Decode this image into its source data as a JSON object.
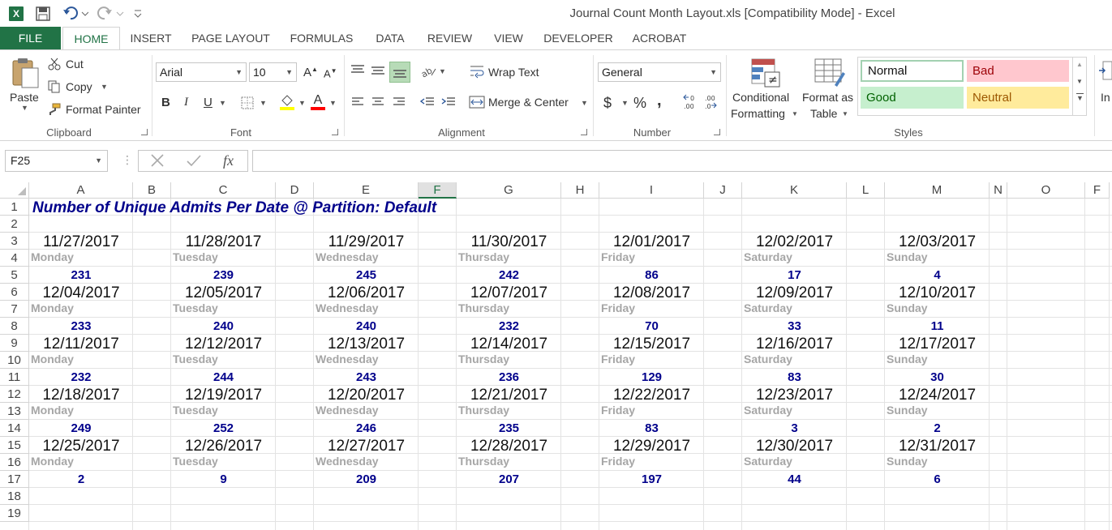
{
  "title_bar": {
    "window_title": "Journal Count Month Layout.xls  [Compatibility Mode] - Excel"
  },
  "tabs": [
    "FILE",
    "HOME",
    "INSERT",
    "PAGE LAYOUT",
    "FORMULAS",
    "DATA",
    "REVIEW",
    "VIEW",
    "DEVELOPER",
    "ACROBAT"
  ],
  "ribbon": {
    "clipboard": {
      "paste": "Paste",
      "cut": "Cut",
      "copy": "Copy",
      "format_painter": "Format Painter",
      "label": "Clipboard"
    },
    "font": {
      "name": "Arial",
      "size": "10",
      "bold": "B",
      "italic": "I",
      "underline": "U",
      "label": "Font"
    },
    "alignment": {
      "wrap_text": "Wrap Text",
      "merge_center": "Merge & Center",
      "label": "Alignment"
    },
    "number": {
      "format": "General",
      "currency": "$",
      "percent": "%",
      "comma": ",",
      "label": "Number"
    },
    "styles": {
      "conditional_1": "Conditional",
      "conditional_2": "Formatting",
      "format_table_1": "Format as",
      "format_table_2": "Table",
      "normal": "Normal",
      "bad": "Bad",
      "good": "Good",
      "neutral": "Neutral",
      "label": "Styles",
      "colors": {
        "bad_bg": "#ffc7ce",
        "bad_fg": "#9c0006",
        "good_bg": "#c6efce",
        "good_fg": "#006100",
        "neutral_bg": "#ffeb9c",
        "neutral_fg": "#9c5700"
      }
    },
    "cells_cut": "In"
  },
  "formula_bar": {
    "name_box": "F25",
    "fx": "fx"
  },
  "columns": [
    "A",
    "B",
    "C",
    "D",
    "E",
    "F",
    "G",
    "H",
    "I",
    "J",
    "K",
    "L",
    "M",
    "N",
    "O",
    "F"
  ],
  "selected_column": "F",
  "rows": [
    "1",
    "2",
    "3",
    "4",
    "5",
    "6",
    "7",
    "8",
    "9",
    "10",
    "11",
    "12",
    "13",
    "14",
    "15",
    "16",
    "17",
    "18",
    "19"
  ],
  "sheet": {
    "title": "Number of Unique Admits Per Date @ Partition: Default",
    "weekdays": [
      "Monday",
      "Tuesday",
      "Wednesday",
      "Thursday",
      "Friday",
      "Saturday",
      "Sunday"
    ],
    "weeks": [
      {
        "dates": [
          "11/27/2017",
          "11/28/2017",
          "11/29/2017",
          "11/30/2017",
          "12/01/2017",
          "12/02/2017",
          "12/03/2017"
        ],
        "counts": [
          "231",
          "239",
          "245",
          "242",
          "86",
          "17",
          "4"
        ]
      },
      {
        "dates": [
          "12/04/2017",
          "12/05/2017",
          "12/06/2017",
          "12/07/2017",
          "12/08/2017",
          "12/09/2017",
          "12/10/2017"
        ],
        "counts": [
          "233",
          "240",
          "240",
          "232",
          "70",
          "33",
          "11"
        ]
      },
      {
        "dates": [
          "12/11/2017",
          "12/12/2017",
          "12/13/2017",
          "12/14/2017",
          "12/15/2017",
          "12/16/2017",
          "12/17/2017"
        ],
        "counts": [
          "232",
          "244",
          "243",
          "236",
          "129",
          "83",
          "30"
        ]
      },
      {
        "dates": [
          "12/18/2017",
          "12/19/2017",
          "12/20/2017",
          "12/21/2017",
          "12/22/2017",
          "12/23/2017",
          "12/24/2017"
        ],
        "counts": [
          "249",
          "252",
          "246",
          "235",
          "83",
          "3",
          "2"
        ]
      },
      {
        "dates": [
          "12/25/2017",
          "12/26/2017",
          "12/27/2017",
          "12/28/2017",
          "12/29/2017",
          "12/30/2017",
          "12/31/2017"
        ],
        "counts": [
          "2",
          "9",
          "209",
          "207",
          "197",
          "44",
          "6"
        ]
      }
    ]
  },
  "colors": {
    "excel_green": "#217346",
    "title_blue": "#00008b",
    "day_gray": "#a6a6a6"
  }
}
